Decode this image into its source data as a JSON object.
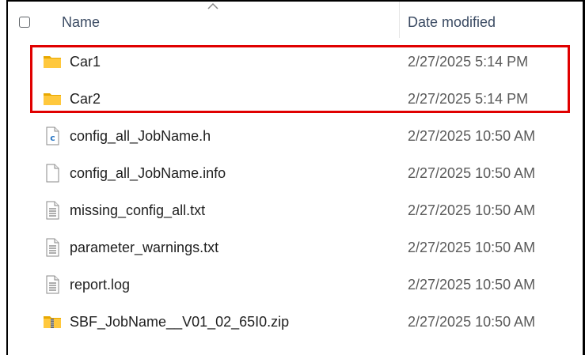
{
  "header": {
    "name_label": "Name",
    "date_label": "Date modified"
  },
  "highlight": {
    "color": "#e00000"
  },
  "files": [
    {
      "name": "Car1",
      "date": "2/27/2025 5:14 PM",
      "icon": "folder-icon"
    },
    {
      "name": "Car2",
      "date": "2/27/2025 5:14 PM",
      "icon": "folder-icon"
    },
    {
      "name": "config_all_JobName.h",
      "date": "2/27/2025 10:50 AM",
      "icon": "c-file-icon"
    },
    {
      "name": "config_all_JobName.info",
      "date": "2/27/2025 10:50 AM",
      "icon": "blank-file-icon"
    },
    {
      "name": "missing_config_all.txt",
      "date": "2/27/2025 10:50 AM",
      "icon": "text-file-icon"
    },
    {
      "name": "parameter_warnings.txt",
      "date": "2/27/2025 10:50 AM",
      "icon": "text-file-icon"
    },
    {
      "name": "report.log",
      "date": "2/27/2025 10:50 AM",
      "icon": "text-file-icon"
    },
    {
      "name": "SBF_JobName__V01_02_65I0.zip",
      "date": "2/27/2025 10:50 AM",
      "icon": "zip-folder-icon"
    }
  ]
}
